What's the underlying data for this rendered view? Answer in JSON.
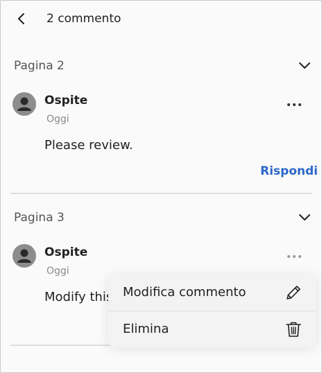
{
  "header": {
    "title": "2 commento"
  },
  "sections": [
    {
      "title": "Pagina 2",
      "comment": {
        "author": "Ospite",
        "date": "Oggi",
        "text": "Please review.",
        "reply_label": "Rispondi"
      }
    },
    {
      "title": "Pagina 3",
      "comment": {
        "author": "Ospite",
        "date": "Oggi",
        "text": "Modify this"
      }
    }
  ],
  "context_menu": {
    "edit_label": "Modifica commento",
    "delete_label": "Elimina"
  },
  "icons": {
    "back": "chevron-left-icon",
    "collapse": "chevron-down-icon",
    "more": "more-horizontal-icon",
    "avatar": "user-avatar-icon",
    "edit": "pencil-icon",
    "delete": "trash-icon"
  },
  "colors": {
    "accent": "#2b67c9",
    "avatar_bg": "#8d8d8d",
    "menu_bg": "#f3f3f3"
  }
}
